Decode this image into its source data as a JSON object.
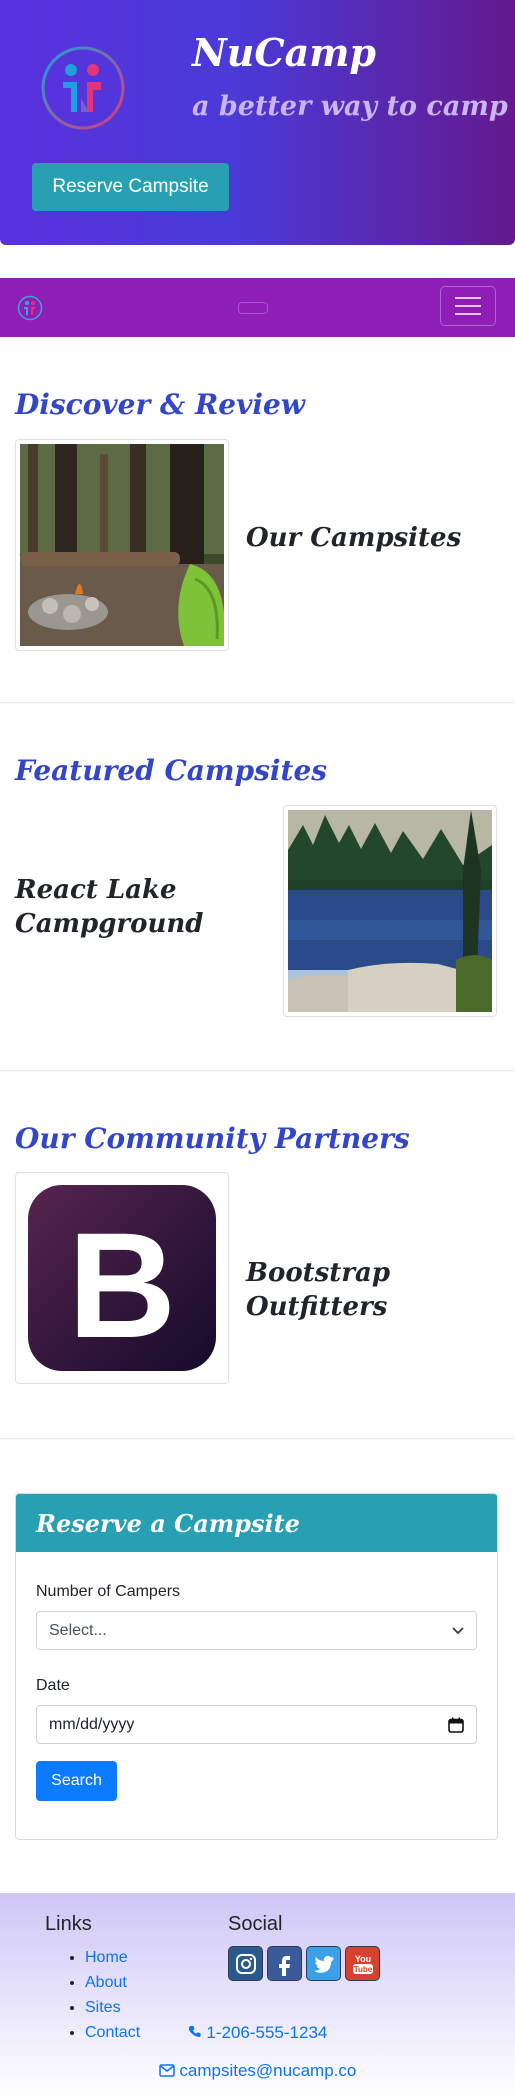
{
  "header": {
    "brand": "NuCamp",
    "tagline": "a better way to camp",
    "reserve_button": "Reserve Campsite"
  },
  "sections": {
    "discover": {
      "heading": "Discover & Review",
      "item_title": "Our Campsites"
    },
    "featured": {
      "heading": "Featured Campsites",
      "item_title": "React Lake Campground"
    },
    "partners": {
      "heading": "Our Community Partners",
      "item_title": "Bootstrap Outfitters"
    }
  },
  "reserve_form": {
    "title": "Reserve a Campsite",
    "campers_label": "Number of Campers",
    "campers_value": "Select...",
    "date_label": "Date",
    "date_placeholder": "mm/dd/yyyy",
    "search_button": "Search"
  },
  "footer": {
    "links_heading": "Links",
    "links": [
      "Home",
      "About",
      "Sites",
      "Contact"
    ],
    "social_heading": "Social",
    "social_icons": [
      "instagram-icon",
      "facebook-icon",
      "twitter-icon",
      "youtube-icon"
    ],
    "phone": "1-206-555-1234",
    "email": "campsites@nucamp.co"
  },
  "colors": {
    "header_gradient_start": "#5a31dd",
    "header_gradient_end": "#641a8e",
    "navbar": "#8f1eb6",
    "heading_blue": "#3446c8",
    "teal": "#28a0b4",
    "primary": "#0d7bff",
    "link": "#0b74f0"
  }
}
